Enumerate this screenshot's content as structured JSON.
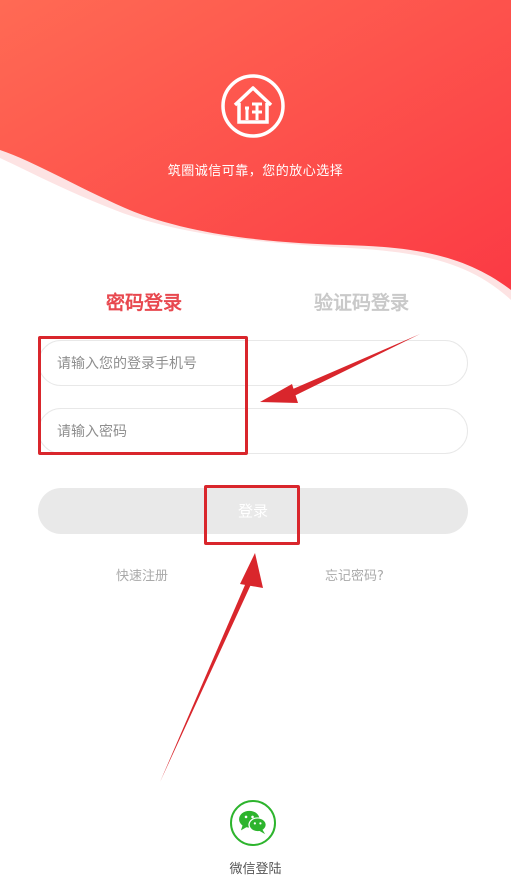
{
  "header": {
    "slogan": "筑圈诚信可靠，您的放心选择",
    "logo_icon": "house-logo-icon",
    "gradient_start": "#ff5a4d",
    "gradient_end": "#fd3c44"
  },
  "tabs": [
    {
      "label": "密码登录",
      "active": true,
      "color": "#e8484f"
    },
    {
      "label": "验证码登录",
      "active": false,
      "color": "#c9c9c9"
    }
  ],
  "form": {
    "phone_placeholder": "请输入您的登录手机号",
    "phone_value": "",
    "password_placeholder": "请输入密码",
    "password_value": ""
  },
  "login_button": {
    "label": "登录",
    "enabled": false
  },
  "links": {
    "register": "快速注册",
    "forgot": "忘记密码?"
  },
  "wechat": {
    "label": "微信登陆",
    "icon": "wechat-icon",
    "color": "#2db42d"
  },
  "annotation_color": "#d9262c"
}
